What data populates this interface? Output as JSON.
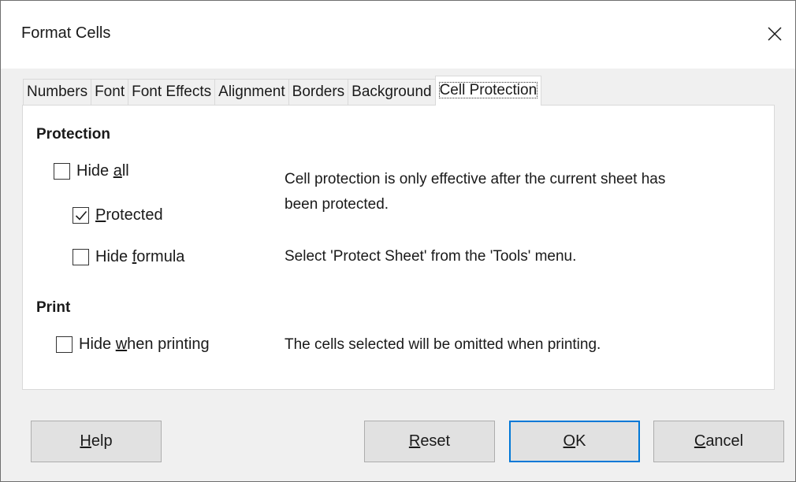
{
  "window": {
    "title": "Format Cells"
  },
  "tabs": [
    {
      "label": "Numbers",
      "active": false
    },
    {
      "label": "Font",
      "active": false
    },
    {
      "label": "Font Effects",
      "active": false
    },
    {
      "label": "Alignment",
      "active": false
    },
    {
      "label": "Borders",
      "active": false
    },
    {
      "label": "Background",
      "active": false
    },
    {
      "label": "Cell Protection",
      "active": true
    }
  ],
  "protection": {
    "heading": "Protection",
    "hide_all": {
      "pre": "Hide ",
      "key": "a",
      "post": "ll",
      "checked": false
    },
    "protected": {
      "pre": "",
      "key": "P",
      "post": "rotected",
      "checked": true
    },
    "hide_formula": {
      "pre": "Hide ",
      "key": "f",
      "post": "ormula",
      "checked": false
    },
    "info_line1": "Cell protection is only effective after the current sheet has",
    "info_line2": "been protected.",
    "info_tools": "Select 'Protect Sheet' from the 'Tools' menu."
  },
  "print": {
    "heading": "Print",
    "hide_when_printing": {
      "pre": "Hide ",
      "key": "w",
      "post": "hen printing",
      "checked": false
    },
    "info": "The cells selected will be omitted when printing."
  },
  "buttons": {
    "help": {
      "key": "H",
      "rest": "elp"
    },
    "reset": {
      "key": "R",
      "rest": "eset"
    },
    "ok": {
      "key": "O",
      "rest": "K"
    },
    "cancel": {
      "key": "C",
      "rest": "ancel"
    }
  },
  "colors": {
    "accent": "#0078d7",
    "dialog_bg": "#f0f0f0",
    "panel_bg": "#ffffff"
  }
}
